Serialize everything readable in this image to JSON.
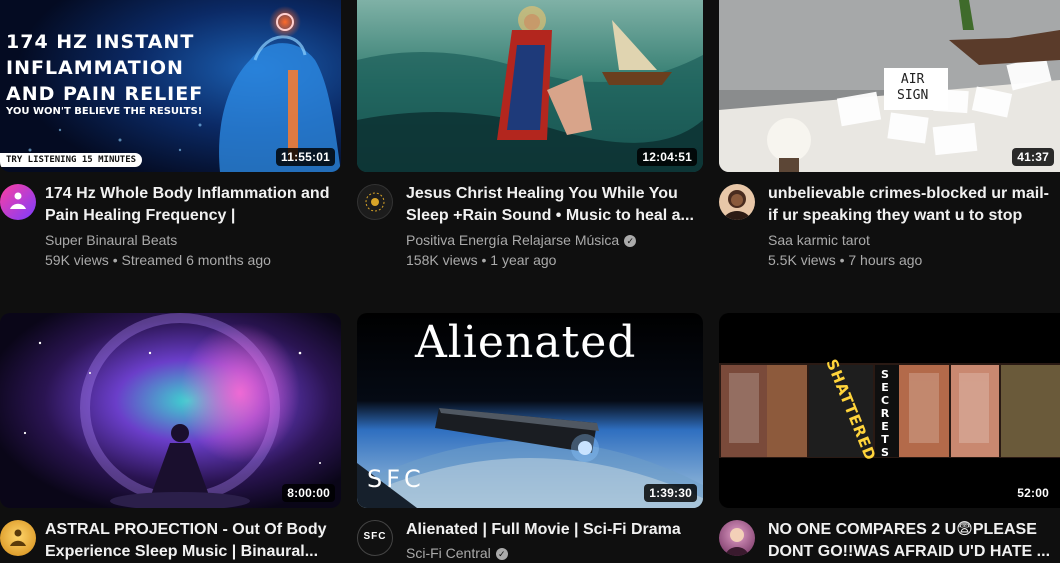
{
  "videos": [
    {
      "title_line1": "174 Hz Whole Body Inflammation and",
      "title_line2": "Pain Healing Frequency |",
      "channel": "Super Binaural Beats",
      "verified": false,
      "meta": "59K views • Streamed 6 months ago",
      "duration": "11:55:01",
      "thumb_line1": "174 HZ INSTANT",
      "thumb_line2": "INFLAMMATION",
      "thumb_line3": "AND PAIN RELIEF",
      "thumb_line4": "YOU WON'T BELIEVE THE RESULTS!",
      "thumb_badge": "TRY LISTENING 15 MINUTES"
    },
    {
      "title_line1": "Jesus Christ Healing You While You",
      "title_line2": "Sleep +Rain Sound • Music to heal a...",
      "channel": "Positiva Energía Relajarse Música",
      "verified": true,
      "meta": "158K views • 1 year ago",
      "duration": "12:04:51"
    },
    {
      "title_line1": "unbelievable crimes-blocked ur mail-",
      "title_line2": "if ur speaking they want u to stop",
      "channel": "Saa karmic tarot",
      "verified": false,
      "meta": "5.5K views • 7 hours ago",
      "duration": "41:37",
      "thumb_card1": "AIR",
      "thumb_card2": "SIGN"
    },
    {
      "title_line1": "ASTRAL PROJECTION - Out Of Body",
      "title_line2": "Experience Sleep Music | Binaural...",
      "duration": "8:00:00"
    },
    {
      "title_line1": "Alienated | Full Movie | Sci-Fi Drama",
      "channel": "Sci-Fi Central",
      "verified": true,
      "duration": "1:39:30",
      "thumb_title": "Alienated",
      "thumb_logo": "SFC",
      "avatar_text": "SFC"
    },
    {
      "title_line1": "NO ONE COMPARES 2 U😨PLEASE",
      "title_line2": "DONT GO!!WAS AFRAID U'D HATE ...",
      "duration": "52:00",
      "thumb_word": "SHATTERED",
      "thumb_vertical": "SECRETS"
    }
  ],
  "colors": {
    "background": "#0f0f0f",
    "text_primary": "#f1f1f1",
    "text_secondary": "#aaaaaa"
  }
}
